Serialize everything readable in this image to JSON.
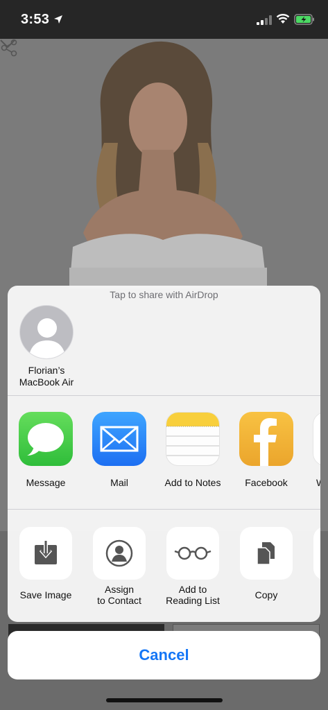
{
  "status_bar": {
    "time": "3:53"
  },
  "share_sheet": {
    "airdrop_title": "Tap to share with AirDrop",
    "device": {
      "name": "Florian’s\nMacBook Air"
    },
    "apps": [
      {
        "label": "Message",
        "icon": "messages-icon"
      },
      {
        "label": "Mail",
        "icon": "mail-icon"
      },
      {
        "label": "Add to Notes",
        "icon": "notes-icon"
      },
      {
        "label": "Facebook",
        "icon": "facebook-icon"
      },
      {
        "label": "W",
        "icon": "partial-app-icon"
      }
    ],
    "actions": [
      {
        "label": "Save Image",
        "icon": "save-image-icon"
      },
      {
        "label": "Assign\nto Contact",
        "icon": "contact-icon"
      },
      {
        "label": "Add to\nReading List",
        "icon": "glasses-icon"
      },
      {
        "label": "Copy",
        "icon": "copy-icon"
      }
    ],
    "cancel_label": "Cancel"
  },
  "colors": {
    "accent": "#1476f6",
    "sheet_background": "#f6f6f6",
    "dim_overlay": "#6f6f6f"
  }
}
